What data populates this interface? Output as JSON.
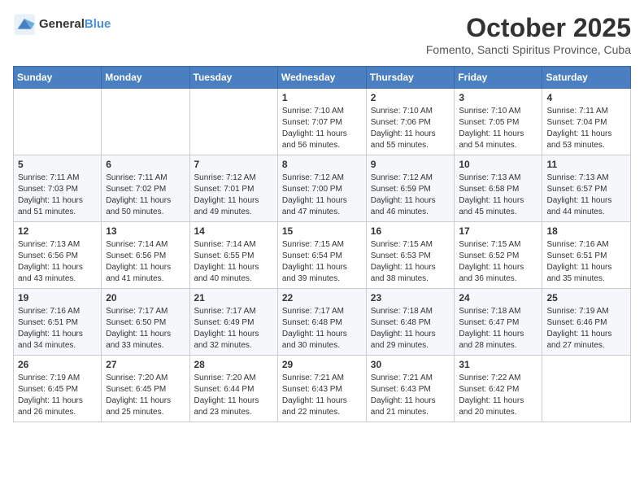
{
  "header": {
    "logo_general": "General",
    "logo_blue": "Blue",
    "month": "October 2025",
    "location": "Fomento, Sancti Spiritus Province, Cuba"
  },
  "weekdays": [
    "Sunday",
    "Monday",
    "Tuesday",
    "Wednesday",
    "Thursday",
    "Friday",
    "Saturday"
  ],
  "weeks": [
    [
      {
        "day": "",
        "info": ""
      },
      {
        "day": "",
        "info": ""
      },
      {
        "day": "",
        "info": ""
      },
      {
        "day": "1",
        "info": "Sunrise: 7:10 AM\nSunset: 7:07 PM\nDaylight: 11 hours and 56 minutes."
      },
      {
        "day": "2",
        "info": "Sunrise: 7:10 AM\nSunset: 7:06 PM\nDaylight: 11 hours and 55 minutes."
      },
      {
        "day": "3",
        "info": "Sunrise: 7:10 AM\nSunset: 7:05 PM\nDaylight: 11 hours and 54 minutes."
      },
      {
        "day": "4",
        "info": "Sunrise: 7:11 AM\nSunset: 7:04 PM\nDaylight: 11 hours and 53 minutes."
      }
    ],
    [
      {
        "day": "5",
        "info": "Sunrise: 7:11 AM\nSunset: 7:03 PM\nDaylight: 11 hours and 51 minutes."
      },
      {
        "day": "6",
        "info": "Sunrise: 7:11 AM\nSunset: 7:02 PM\nDaylight: 11 hours and 50 minutes."
      },
      {
        "day": "7",
        "info": "Sunrise: 7:12 AM\nSunset: 7:01 PM\nDaylight: 11 hours and 49 minutes."
      },
      {
        "day": "8",
        "info": "Sunrise: 7:12 AM\nSunset: 7:00 PM\nDaylight: 11 hours and 47 minutes."
      },
      {
        "day": "9",
        "info": "Sunrise: 7:12 AM\nSunset: 6:59 PM\nDaylight: 11 hours and 46 minutes."
      },
      {
        "day": "10",
        "info": "Sunrise: 7:13 AM\nSunset: 6:58 PM\nDaylight: 11 hours and 45 minutes."
      },
      {
        "day": "11",
        "info": "Sunrise: 7:13 AM\nSunset: 6:57 PM\nDaylight: 11 hours and 44 minutes."
      }
    ],
    [
      {
        "day": "12",
        "info": "Sunrise: 7:13 AM\nSunset: 6:56 PM\nDaylight: 11 hours and 43 minutes."
      },
      {
        "day": "13",
        "info": "Sunrise: 7:14 AM\nSunset: 6:56 PM\nDaylight: 11 hours and 41 minutes."
      },
      {
        "day": "14",
        "info": "Sunrise: 7:14 AM\nSunset: 6:55 PM\nDaylight: 11 hours and 40 minutes."
      },
      {
        "day": "15",
        "info": "Sunrise: 7:15 AM\nSunset: 6:54 PM\nDaylight: 11 hours and 39 minutes."
      },
      {
        "day": "16",
        "info": "Sunrise: 7:15 AM\nSunset: 6:53 PM\nDaylight: 11 hours and 38 minutes."
      },
      {
        "day": "17",
        "info": "Sunrise: 7:15 AM\nSunset: 6:52 PM\nDaylight: 11 hours and 36 minutes."
      },
      {
        "day": "18",
        "info": "Sunrise: 7:16 AM\nSunset: 6:51 PM\nDaylight: 11 hours and 35 minutes."
      }
    ],
    [
      {
        "day": "19",
        "info": "Sunrise: 7:16 AM\nSunset: 6:51 PM\nDaylight: 11 hours and 34 minutes."
      },
      {
        "day": "20",
        "info": "Sunrise: 7:17 AM\nSunset: 6:50 PM\nDaylight: 11 hours and 33 minutes."
      },
      {
        "day": "21",
        "info": "Sunrise: 7:17 AM\nSunset: 6:49 PM\nDaylight: 11 hours and 32 minutes."
      },
      {
        "day": "22",
        "info": "Sunrise: 7:17 AM\nSunset: 6:48 PM\nDaylight: 11 hours and 30 minutes."
      },
      {
        "day": "23",
        "info": "Sunrise: 7:18 AM\nSunset: 6:48 PM\nDaylight: 11 hours and 29 minutes."
      },
      {
        "day": "24",
        "info": "Sunrise: 7:18 AM\nSunset: 6:47 PM\nDaylight: 11 hours and 28 minutes."
      },
      {
        "day": "25",
        "info": "Sunrise: 7:19 AM\nSunset: 6:46 PM\nDaylight: 11 hours and 27 minutes."
      }
    ],
    [
      {
        "day": "26",
        "info": "Sunrise: 7:19 AM\nSunset: 6:45 PM\nDaylight: 11 hours and 26 minutes."
      },
      {
        "day": "27",
        "info": "Sunrise: 7:20 AM\nSunset: 6:45 PM\nDaylight: 11 hours and 25 minutes."
      },
      {
        "day": "28",
        "info": "Sunrise: 7:20 AM\nSunset: 6:44 PM\nDaylight: 11 hours and 23 minutes."
      },
      {
        "day": "29",
        "info": "Sunrise: 7:21 AM\nSunset: 6:43 PM\nDaylight: 11 hours and 22 minutes."
      },
      {
        "day": "30",
        "info": "Sunrise: 7:21 AM\nSunset: 6:43 PM\nDaylight: 11 hours and 21 minutes."
      },
      {
        "day": "31",
        "info": "Sunrise: 7:22 AM\nSunset: 6:42 PM\nDaylight: 11 hours and 20 minutes."
      },
      {
        "day": "",
        "info": ""
      }
    ]
  ]
}
